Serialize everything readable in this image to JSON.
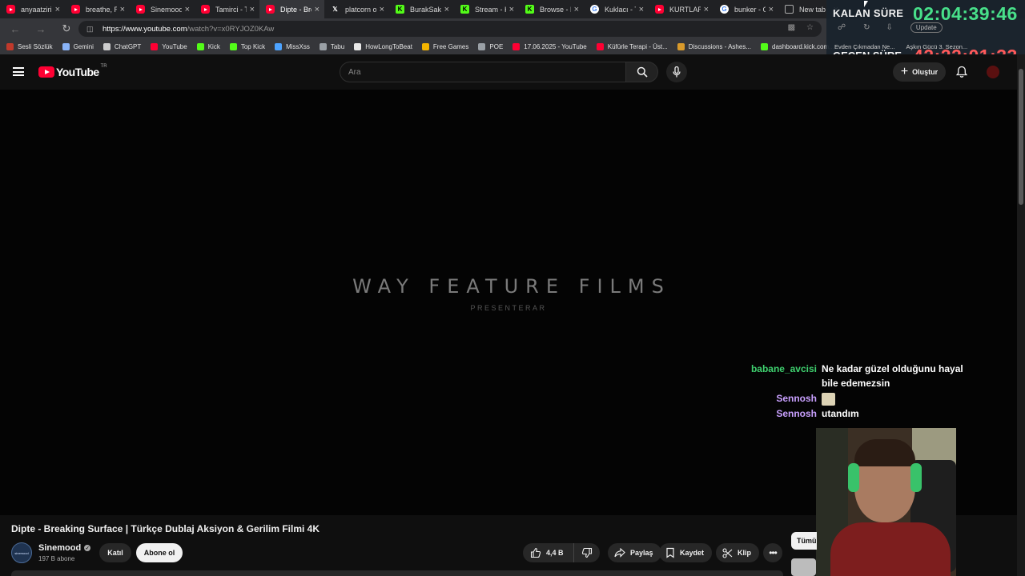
{
  "browser": {
    "tabs": [
      {
        "label": "anyaatziri",
        "favicon": "youtube-icon",
        "active": false
      },
      {
        "label": "breathe, Ru",
        "favicon": "youtube-icon",
        "active": false
      },
      {
        "label": "Sinemood",
        "favicon": "youtube-icon",
        "active": false
      },
      {
        "label": "Tamirci - Th",
        "favicon": "youtube-icon",
        "active": false
      },
      {
        "label": "Dipte - Brea",
        "favicon": "youtube-icon",
        "active": true
      },
      {
        "label": "platcorn on",
        "favicon": "x-icon",
        "active": false
      },
      {
        "label": "BurakSakin",
        "favicon": "kick-icon",
        "active": false
      },
      {
        "label": "Stream - Ki",
        "favicon": "kick-icon",
        "active": false
      },
      {
        "label": "Browse - Ki",
        "favicon": "kick-icon",
        "active": false
      },
      {
        "label": "Kuklacı - Th",
        "favicon": "google-icon",
        "active": false
      },
      {
        "label": "KURTLAR V",
        "favicon": "youtube-icon",
        "active": false
      },
      {
        "label": "bunker - G",
        "favicon": "google-icon",
        "active": false
      },
      {
        "label": "New tab",
        "favicon": "newtab-icon",
        "active": false
      }
    ],
    "url_host": "https://www.youtube.com",
    "url_path": "/watch?v=x0RYJOZ0KAw",
    "update_label": "Update",
    "bookmarks": [
      {
        "label": "Sesli Sözlük",
        "icon": "flag-icon",
        "color": "#c0392b"
      },
      {
        "label": "Gemini",
        "icon": "gemini-icon",
        "color": "#8ab4f8"
      },
      {
        "label": "ChatGPT",
        "icon": "chatgpt-icon",
        "color": "#cccccc"
      },
      {
        "label": "YouTube",
        "icon": "youtube-icon",
        "color": "#ff0033"
      },
      {
        "label": "Kick",
        "icon": "kick-icon",
        "color": "#53fc18"
      },
      {
        "label": "Top Kick",
        "icon": "kick-icon",
        "color": "#53fc18"
      },
      {
        "label": "MissXss",
        "icon": "xss-icon",
        "color": "#4da3ff"
      },
      {
        "label": "Tabu",
        "icon": "cp-icon",
        "color": "#9aa0a6"
      },
      {
        "label": "HowLongToBeat",
        "icon": "hltb-icon",
        "color": "#e8e8e8"
      },
      {
        "label": "Free Games",
        "icon": "tag-icon",
        "color": "#f4b400"
      },
      {
        "label": "POE",
        "icon": "folder-icon",
        "color": "#9aa0a6"
      },
      {
        "label": "17.06.2025 - YouTube",
        "icon": "youtube-icon",
        "color": "#ff0033"
      },
      {
        "label": "Küfürle Terapi - Üst...",
        "icon": "youtube-icon",
        "color": "#ff0033"
      },
      {
        "label": "Discussions - Ashes...",
        "icon": "ashes-icon",
        "color": "#d99a2b"
      },
      {
        "label": "dashboard.kick.com...",
        "icon": "kick-icon",
        "color": "#53fc18"
      }
    ],
    "bookmarks_right": [
      "Evden Çıkmadan Ne...",
      "Aşkın Gücü 3. Sezon..."
    ]
  },
  "overlay": {
    "kalan_label": "KALAN SÜRE",
    "kalan_time": "02:04:39:46",
    "gecen_label": "GEÇEN SÜRE",
    "gecen_time": "42:22:01:33"
  },
  "youtube": {
    "logo_text": "YouTube",
    "region": "TR",
    "search_placeholder": "Ara",
    "create_label": "Oluştur",
    "video_overlay_title": "WAY FEATURE FILMS",
    "video_overlay_sub": "PRESENTERAR",
    "video_title": "Dipte - Breaking Surface | Türkçe Dublaj Aksiyon & Gerilim Filmi 4K",
    "channel_name": "Sinemood",
    "channel_avatar_text": "sinemood",
    "subscribers": "197 B abone",
    "join_label": "Katıl",
    "subscribe_label": "Abone ol",
    "like_count": "4,4 B",
    "share_label": "Paylaş",
    "save_label": "Kaydet",
    "clip_label": "Klip",
    "filter_label": "Tümü"
  },
  "chat": [
    {
      "user": "babane_avcisi",
      "color": "#3fd16f",
      "text": "Ne kadar güzel olduğunu hayal bile edemezsin",
      "emote": false
    },
    {
      "user": "Sennosh",
      "color": "#c9a0ff",
      "text": "",
      "emote": true
    },
    {
      "user": "Sennosh",
      "color": "#c9a0ff",
      "text": "utandım",
      "emote": false
    }
  ],
  "colors": {
    "youtube_red": "#ff0033",
    "kalan_green": "#48e08a",
    "gecen_red": "#ff5a5a",
    "page_bg": "#0f0f0f"
  }
}
